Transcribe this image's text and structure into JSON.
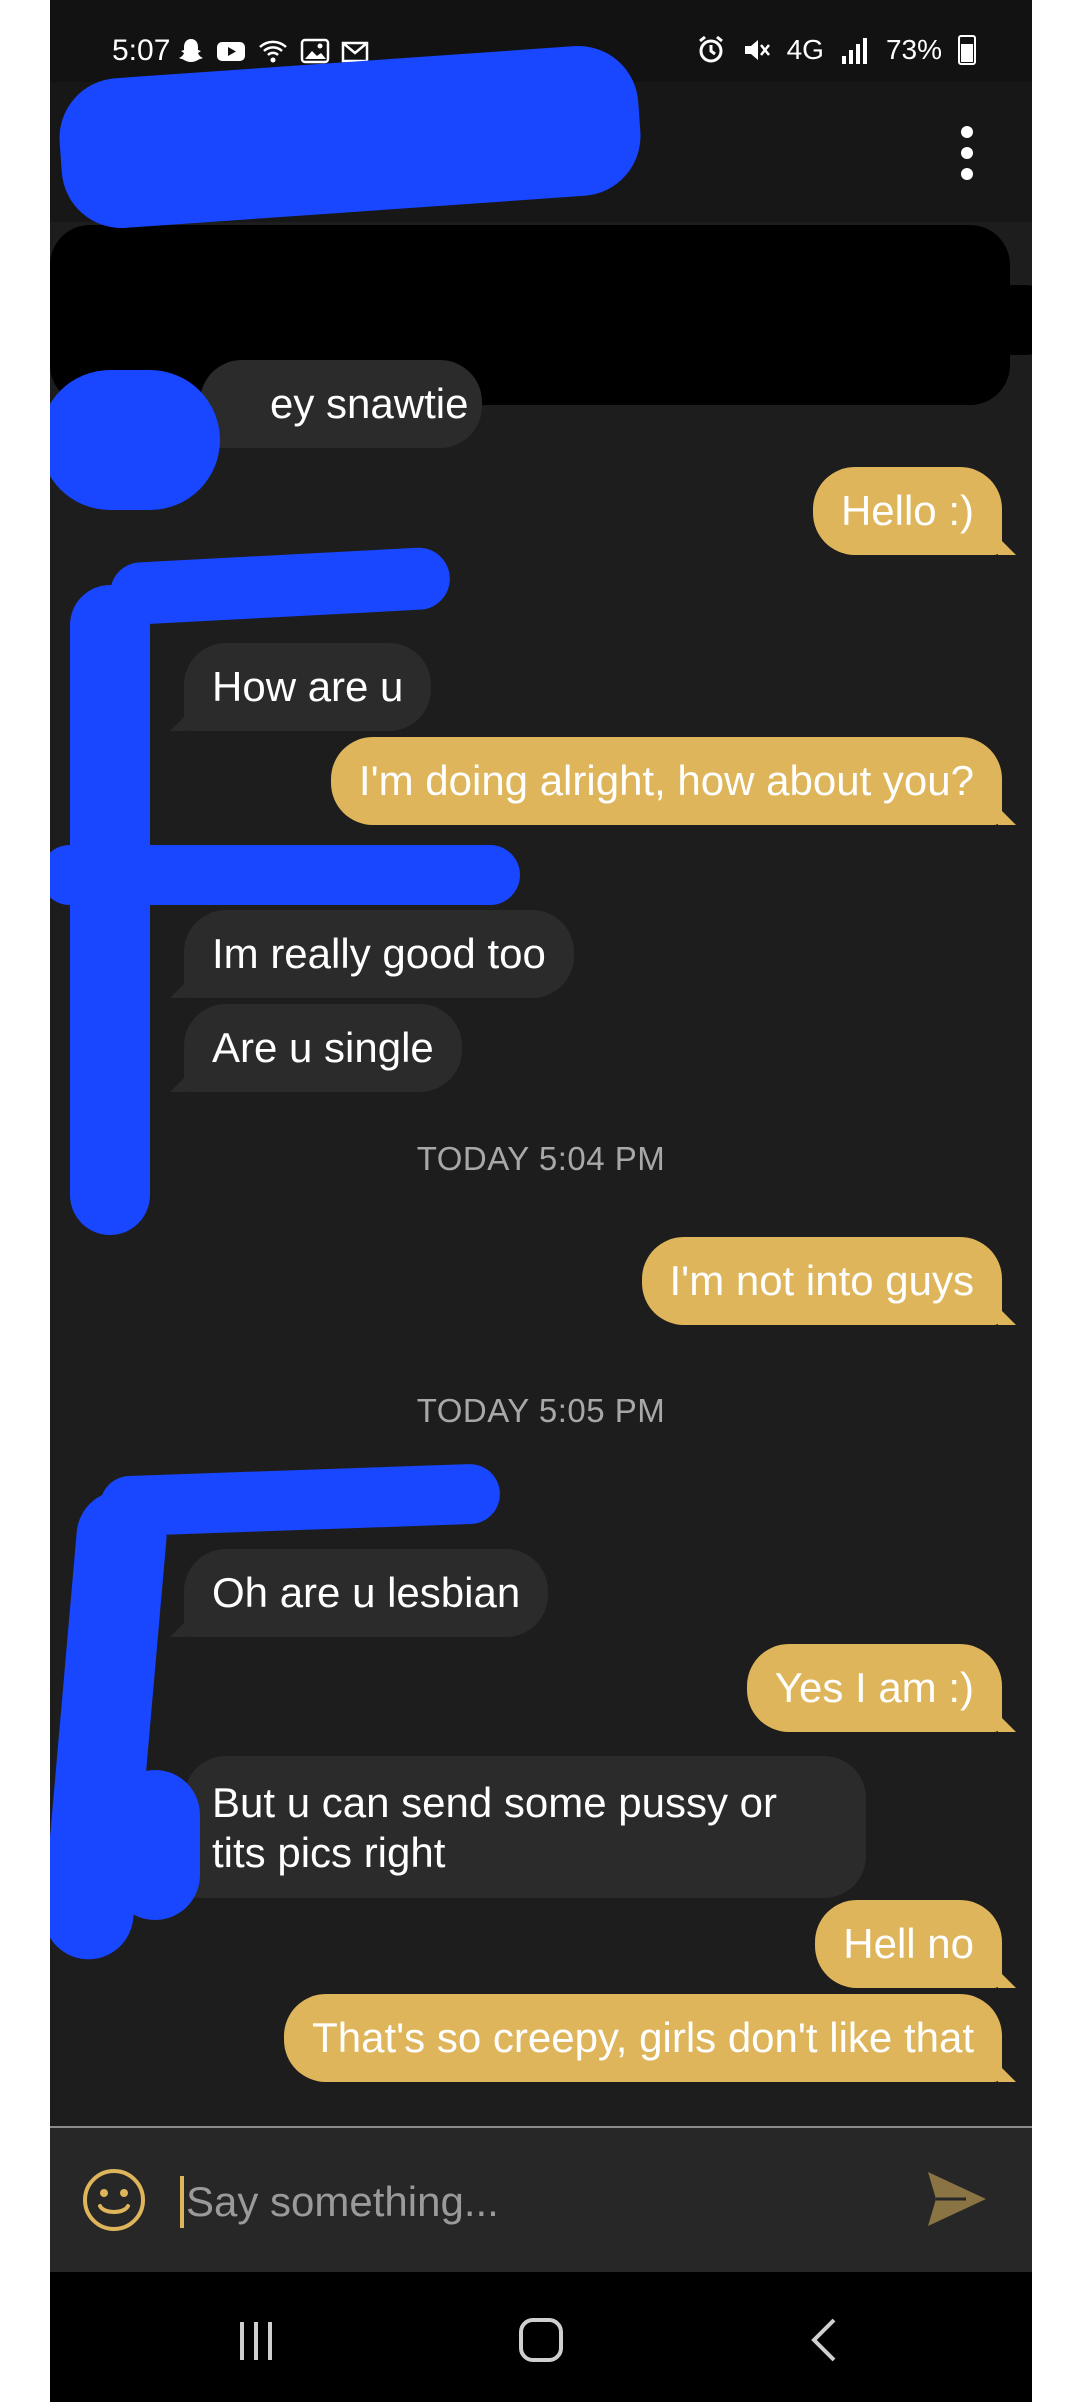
{
  "status_bar": {
    "time": "5:07",
    "network": "4G",
    "battery": "73%"
  },
  "header": {
    "menu_icon": "more-vertical-icon"
  },
  "messages": [
    {
      "dir": "in",
      "text": "ey snawtie"
    },
    {
      "dir": "out",
      "text": "Hello :)"
    },
    {
      "dir": "in",
      "text": "How are u"
    },
    {
      "dir": "out",
      "text": "I'm doing alright, how about you?"
    },
    {
      "dir": "in",
      "text": "Im really good too"
    },
    {
      "dir": "in",
      "text": "Are u single"
    },
    {
      "dir": "out",
      "text": "I'm not into guys"
    },
    {
      "dir": "in",
      "text": "Oh are u lesbian"
    },
    {
      "dir": "out",
      "text": "Yes I am :)"
    },
    {
      "dir": "in",
      "text": "But u can send some pussy or tits pics right"
    },
    {
      "dir": "out",
      "text": "Hell no"
    },
    {
      "dir": "out",
      "text": "That's so creepy, girls don't like that"
    }
  ],
  "timestamps": [
    "TODAY 5:04 PM",
    "TODAY 5:05 PM"
  ],
  "composer": {
    "placeholder": "Say something...",
    "emoji_icon": "smiley-icon",
    "send_icon": "send-icon"
  },
  "colors": {
    "background": "#1d1d1d",
    "outgoing_bubble": "#dfb55b",
    "incoming_bubble": "#2b2b2b",
    "redaction_blue": "#1946ff"
  }
}
